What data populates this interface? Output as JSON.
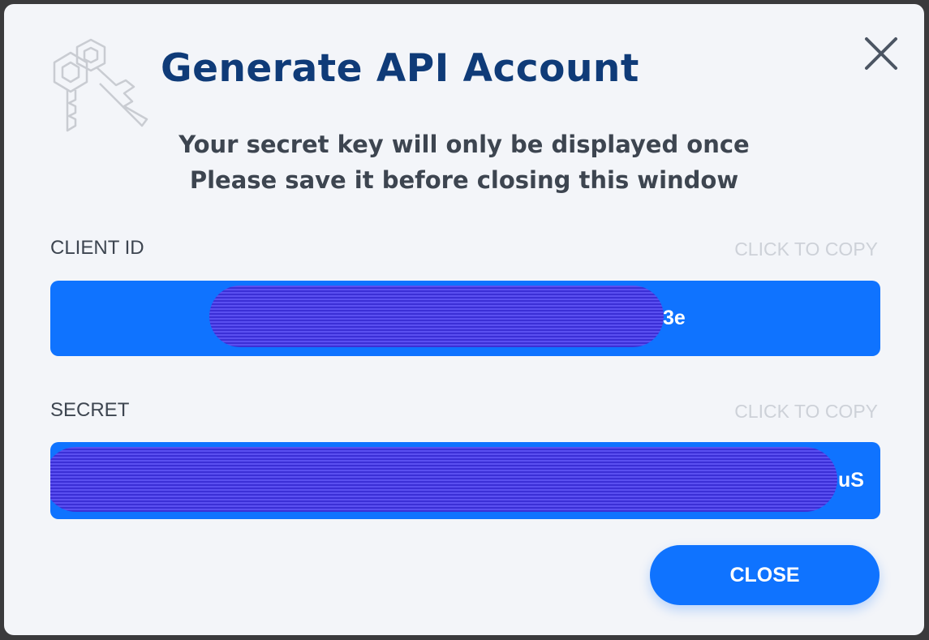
{
  "dialog": {
    "title": "Generate API Account",
    "notice_line1": "Your secret key will only be displayed once",
    "notice_line2": "Please save it before closing this window",
    "close_icon": "close-icon",
    "header_icon": "keys-icon"
  },
  "client_id": {
    "label": "CLIENT ID",
    "copy_label": "CLICK TO COPY",
    "visible_suffix": "3e"
  },
  "secret": {
    "label": "SECRET",
    "copy_label": "CLICK TO COPY",
    "visible_suffix": "uS"
  },
  "footer": {
    "close_label": "CLOSE"
  },
  "colors": {
    "title": "#0f3b78",
    "accent": "#0f73ff",
    "redaction": "#3c31d9",
    "muted": "#cdd1d8"
  }
}
